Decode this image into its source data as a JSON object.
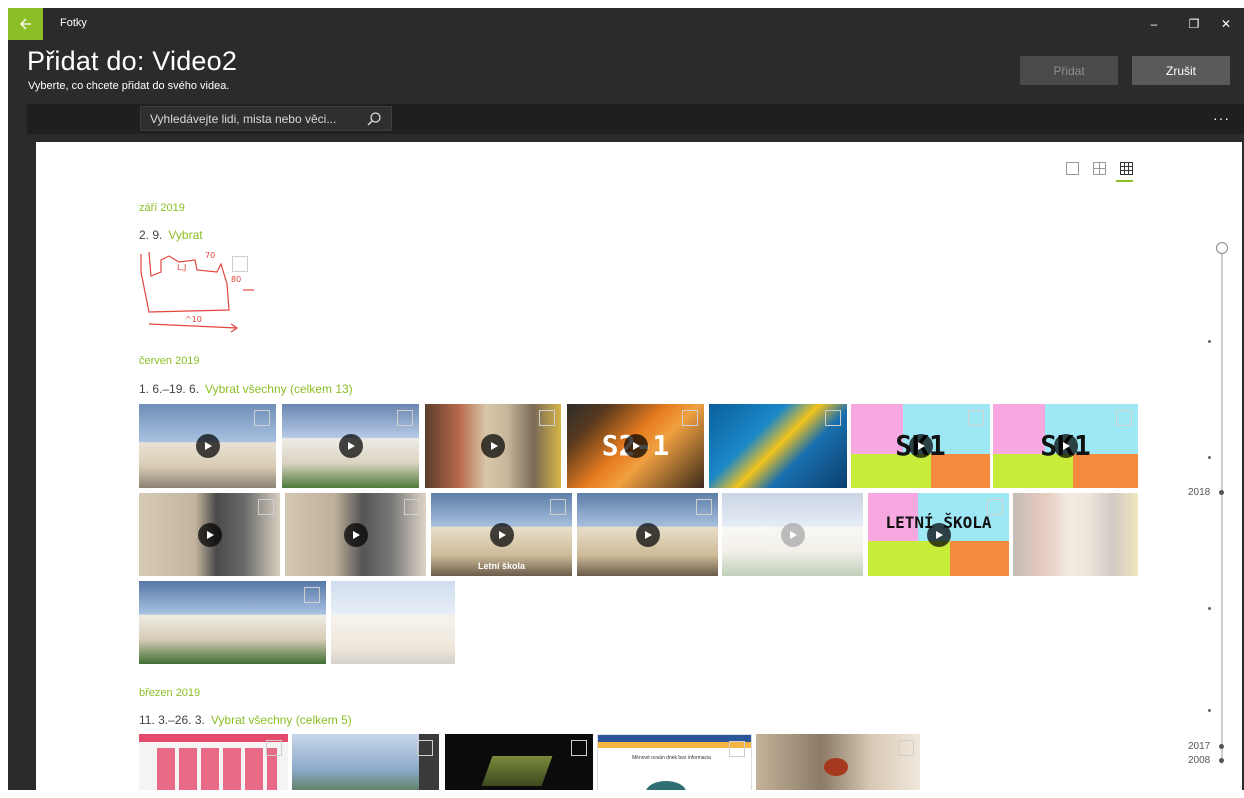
{
  "titlebar": {
    "app_name": "Fotky",
    "minimize": "–",
    "restore": "❐",
    "close": "✕"
  },
  "header": {
    "title": "Přidat do: Video2",
    "subtitle": "Vyberte, co chcete přidat do svého videa.",
    "add_label": "Přidat",
    "cancel_label": "Zrušit"
  },
  "search": {
    "placeholder": "Vyhledávejte lidi, mista nebo věci..."
  },
  "toolbar": {
    "more": "···"
  },
  "groups": [
    {
      "month": "září 2019",
      "range": "2. 9.",
      "select": "Vybrat"
    },
    {
      "month": "červen 2019",
      "range": "1. 6.–19. 6.",
      "select": "Vybrat všechny (celkem 13)"
    },
    {
      "month": "březen 2019",
      "range": "11. 3.–26. 3.",
      "select": "Vybrat všechny (celkem 5)"
    }
  ],
  "thumb_captions": {
    "sk1": "SK1",
    "s21": "S2-1",
    "letni_skola": "LETNÍ ŠKOLA",
    "letni_skola_small": "Letní škola",
    "doc_title": "Měnové oceán dnek bez informacia"
  },
  "timeline": {
    "years": [
      "2018",
      "2017",
      "2008"
    ]
  },
  "colors": {
    "accent": "#8cbf26",
    "window": "#2b2b2b",
    "toolbar": "#1f1f1f"
  }
}
